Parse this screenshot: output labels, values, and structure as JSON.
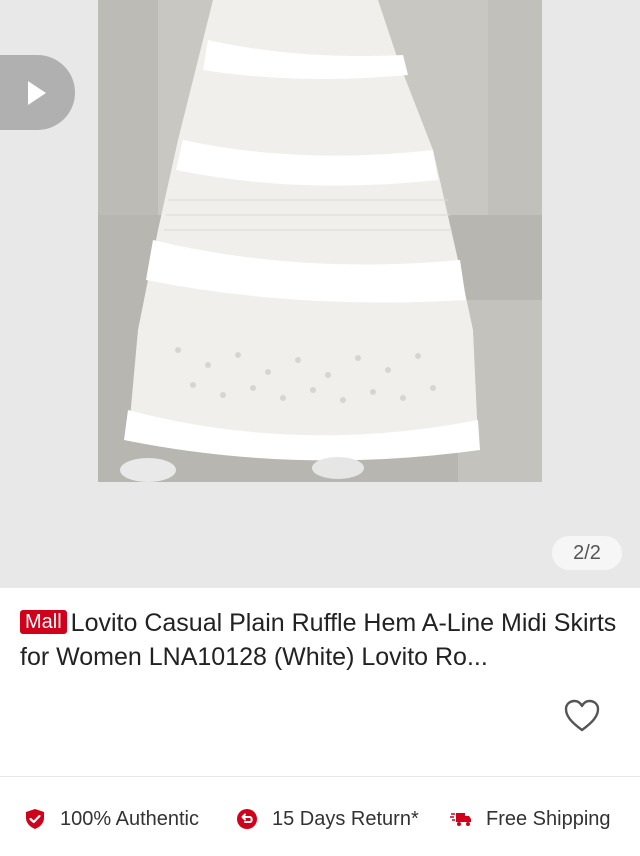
{
  "gallery": {
    "counter": "2/2",
    "play_icon": "play-icon"
  },
  "product": {
    "badge": "Mall",
    "title": "Lovito Casual Plain Ruffle Hem A-Line Midi Skirts for Women LNA10128 (White) Lovito Ro..."
  },
  "assurance": [
    {
      "icon": "shield-check-icon",
      "label": "100% Authentic"
    },
    {
      "icon": "return-icon",
      "label": "15 Days Return*"
    },
    {
      "icon": "truck-icon",
      "label": "Free Shipping"
    }
  ],
  "colors": {
    "accent": "#d0011b",
    "badge_bg": "#d0011b",
    "gallery_bg": "#e8e8e8"
  }
}
